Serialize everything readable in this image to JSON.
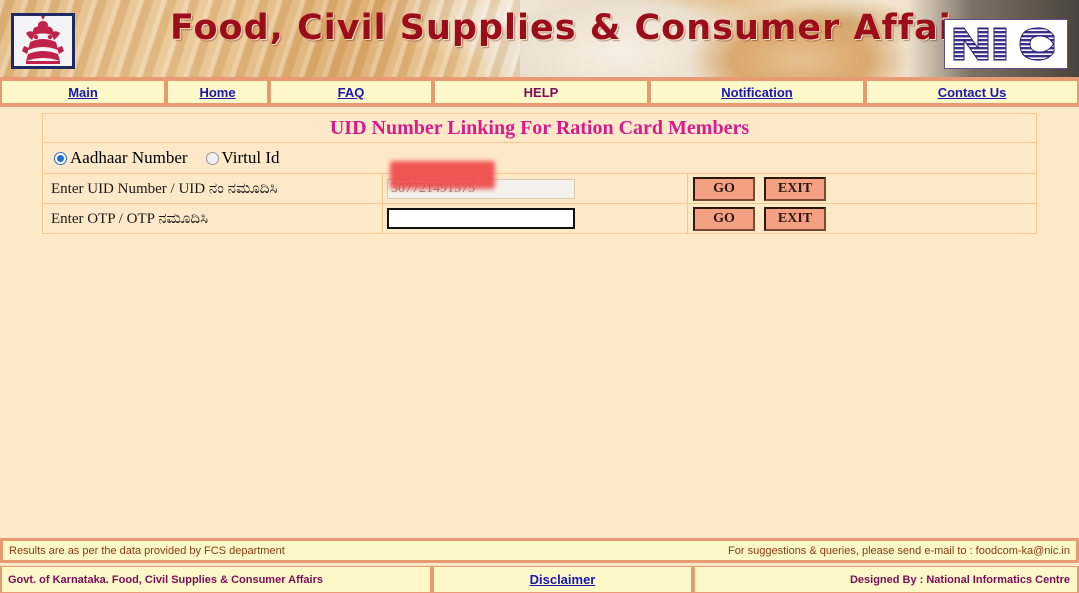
{
  "header": {
    "banner_title": "Food, Civil Supplies & Consumer Affairs",
    "emblem_alt": "Karnataka State Emblem",
    "nic_logo_text": "NIC"
  },
  "nav": {
    "items": [
      {
        "label": "Main",
        "style": "link"
      },
      {
        "label": "Home",
        "style": "link"
      },
      {
        "label": "FAQ",
        "style": "link"
      },
      {
        "label": "HELP",
        "style": "plain"
      },
      {
        "label": "Notification",
        "style": "link"
      },
      {
        "label": "Contact Us",
        "style": "link"
      }
    ]
  },
  "main": {
    "panel_title": "UID Number Linking For Ration Card Members",
    "id_type": {
      "selected": "Aadhaar Number",
      "options": [
        {
          "label": "Aadhaar Number",
          "checked": true
        },
        {
          "label": "Virtul Id",
          "checked": false
        }
      ]
    },
    "rows": [
      {
        "label": "Enter UID Number  / UID ನಂ ನಮೂದಿಸಿ",
        "value": "307721491575",
        "placeholder": "",
        "go_label": "GO",
        "exit_label": "EXIT"
      },
      {
        "label": "Enter OTP  / OTP ನಮೂದಿಸಿ",
        "value": "",
        "placeholder": "",
        "go_label": "GO",
        "exit_label": "EXIT"
      }
    ]
  },
  "footer": {
    "note_left": "Results are as per the data provided by FCS department",
    "note_right": "For suggestions & queries, please send e-mail to : foodcom-ka@nic.in",
    "bar_left": "Govt. of Karnataka. Food, Civil Supplies & Consumer Affairs",
    "bar_mid": "Disclaimer",
    "bar_right": "Designed By : National Informatics Centre"
  },
  "colors": {
    "page_bg": "#fde8c8",
    "accent_border": "#e89b72",
    "nav_bg": "#fdf8c8",
    "link": "#1a18b0",
    "title_pink": "#d81b8c",
    "banner_text": "#9c0d1b",
    "button_bg": "#f4a083",
    "redaction": "#ef4b4b"
  }
}
